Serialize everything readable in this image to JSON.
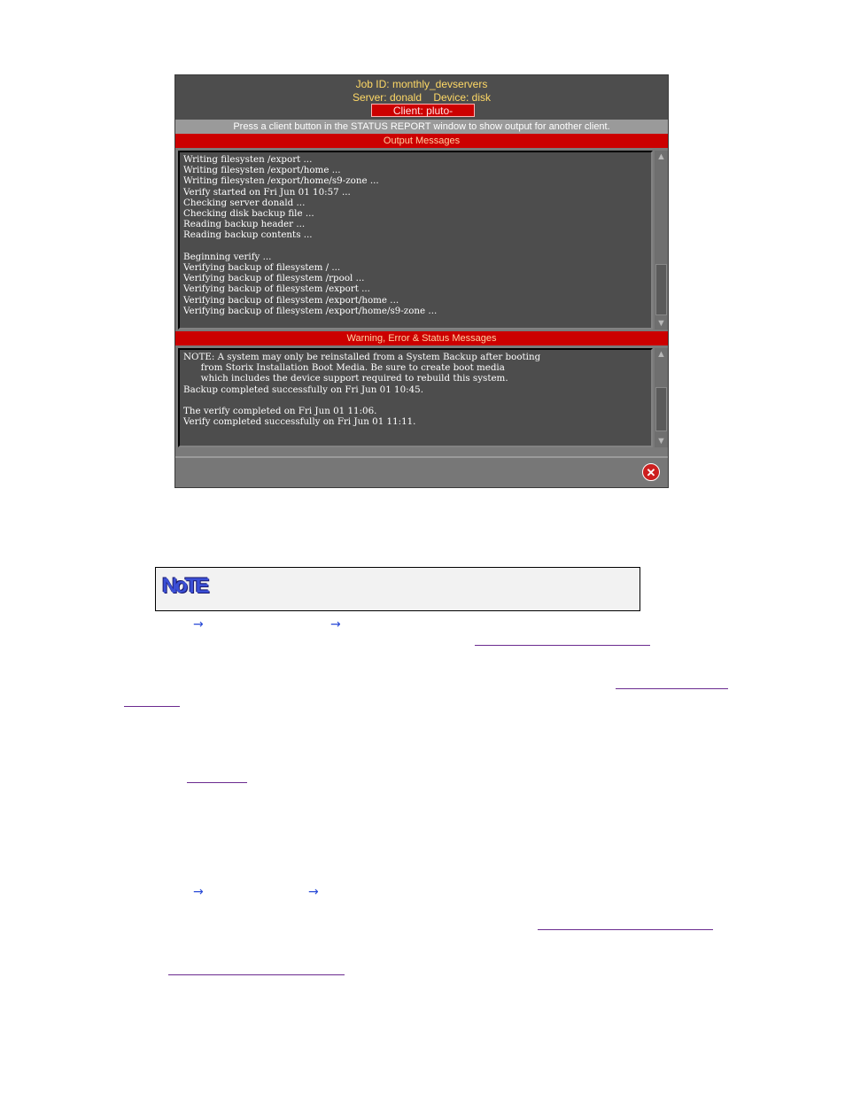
{
  "window": {
    "job_line": "Job ID: monthly_devservers",
    "server_line": "Server: donald    Device: disk",
    "client_badge": "Client: pluto-container",
    "hint": "Press a client button in the STATUS REPORT window to show output for another client.",
    "output_header": "Output Messages",
    "output_lines": [
      "Writing filesysten /export ...",
      "Writing filesysten /export/home ...",
      "Writing filesysten /export/home/s9-zone ...",
      "Verify started on Fri Jun 01 10:57 ...",
      "Checking server donald ...",
      "Checking disk backup file ...",
      "Reading backup header ...",
      "Reading backup contents ...",
      "",
      "Beginning verify ...",
      "Verifying backup of filesystem / ...",
      "Verifying backup of filesystem /rpool ...",
      "Verifying backup of filesystem /export ...",
      "Verifying backup of filesystem /export/home ...",
      "Verifying backup of filesystem /export/home/s9-zone ..."
    ],
    "status_header": "Warning, Error & Status Messages",
    "status_lines": [
      "NOTE: A system may only be reinstalled from a System Backup after booting",
      "      from Storix Installation Boot Media. Be sure to create boot media",
      "      which includes the device support required to rebuild this system.",
      "Backup completed successfully on Fri Jun 01 10:45.",
      "",
      "The verify completed on Fri Jun 01 11:06.",
      "Verify completed successfully on Fri Jun 01 11:11."
    ],
    "close_glyph": "✕"
  },
  "note": {
    "icon_text": "NoTE"
  },
  "arrows": [
    "→",
    "→",
    "→",
    "→"
  ],
  "colors": {
    "accent_red": "#cc0000",
    "header_text": "#ffd966",
    "link": "#6b2b8f",
    "arrow": "#2a4bd7"
  }
}
